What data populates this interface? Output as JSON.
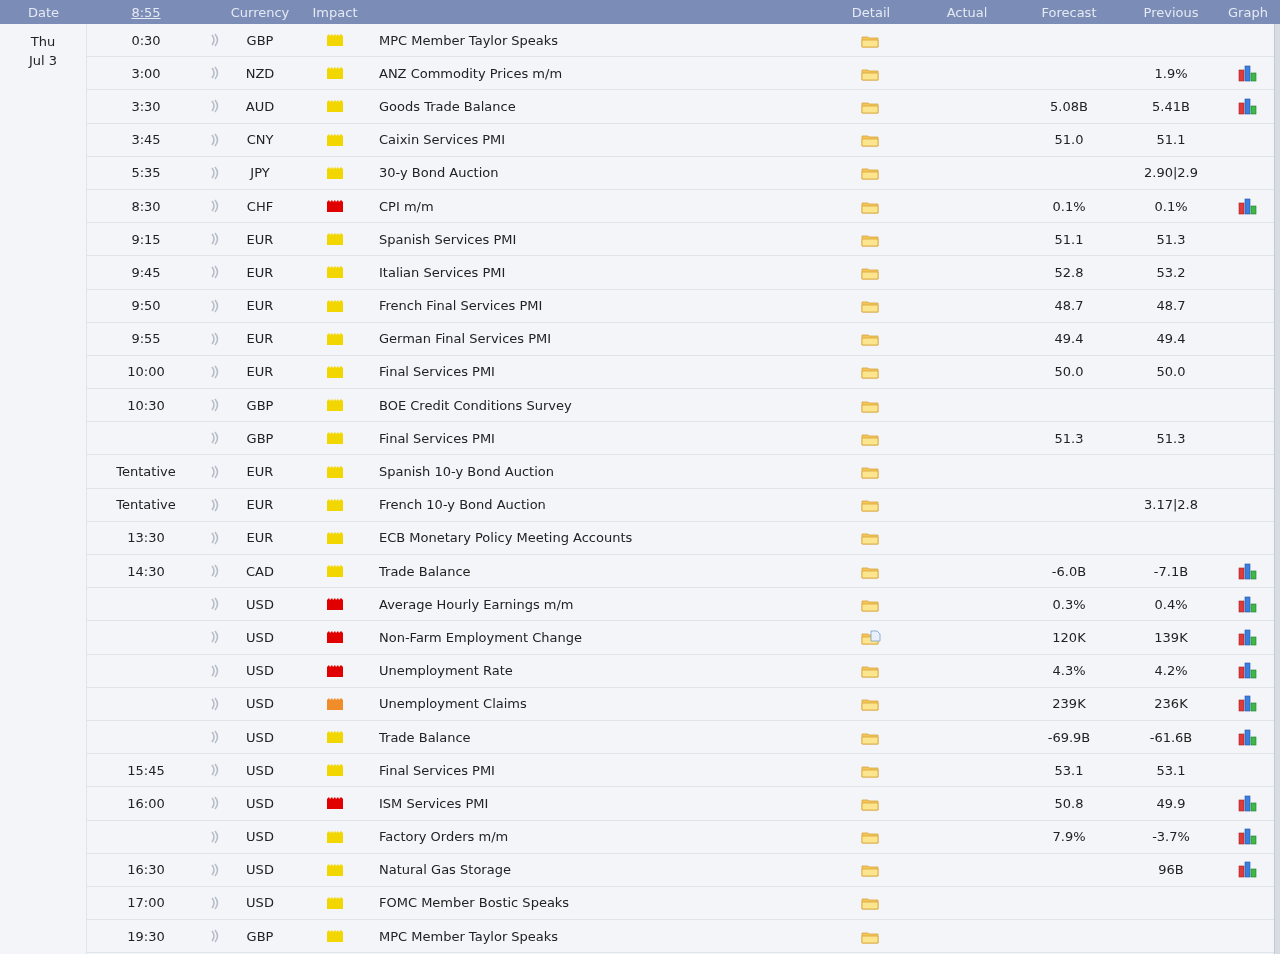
{
  "header": {
    "date": "Date",
    "clock": "8:55",
    "currency": "Currency",
    "impact": "Impact",
    "detail": "Detail",
    "actual": "Actual",
    "forecast": "Forecast",
    "previous": "Previous",
    "graph": "Graph"
  },
  "day": {
    "weekday": "Thu",
    "date": "Jul 3"
  },
  "events": [
    {
      "time": "0:30",
      "currency": "GBP",
      "color": "#f2d600",
      "title": "MPC Member Taylor Speaks",
      "detail_note": false,
      "graph": false
    },
    {
      "time": "3:00",
      "currency": "NZD",
      "color": "#f2d600",
      "title": "ANZ Commodity Prices m/m",
      "detail_note": false,
      "previous": "1.9%",
      "graph": true
    },
    {
      "time": "3:30",
      "currency": "AUD",
      "color": "#f2d600",
      "title": "Goods Trade Balance",
      "detail_note": false,
      "forecast": "5.08B",
      "previous": "5.41B",
      "graph": true
    },
    {
      "time": "3:45",
      "currency": "CNY",
      "color": "#f2d600",
      "title": "Caixin Services PMI",
      "detail_note": false,
      "forecast": "51.0",
      "previous": "51.1",
      "graph": false
    },
    {
      "time": "5:35",
      "currency": "JPY",
      "color": "#f2d600",
      "title": "30-y Bond Auction",
      "detail_note": false,
      "previous": "2.90|2.9",
      "graph": false
    },
    {
      "time": "8:30",
      "currency": "CHF",
      "color": "#e00000",
      "title": "CPI m/m",
      "detail_note": false,
      "forecast": "0.1%",
      "previous": "0.1%",
      "graph": true
    },
    {
      "time": "9:15",
      "currency": "EUR",
      "color": "#f2d600",
      "title": "Spanish Services PMI",
      "detail_note": false,
      "forecast": "51.1",
      "previous": "51.3",
      "graph": false
    },
    {
      "time": "9:45",
      "currency": "EUR",
      "color": "#f2d600",
      "title": "Italian Services PMI",
      "detail_note": false,
      "forecast": "52.8",
      "previous": "53.2",
      "graph": false
    },
    {
      "time": "9:50",
      "currency": "EUR",
      "color": "#f2d600",
      "title": "French Final Services PMI",
      "detail_note": false,
      "forecast": "48.7",
      "previous": "48.7",
      "graph": false
    },
    {
      "time": "9:55",
      "currency": "EUR",
      "color": "#f2d600",
      "title": "German Final Services PMI",
      "detail_note": false,
      "forecast": "49.4",
      "previous": "49.4",
      "graph": false
    },
    {
      "time": "10:00",
      "currency": "EUR",
      "color": "#f2d600",
      "title": "Final Services PMI",
      "detail_note": false,
      "forecast": "50.0",
      "previous": "50.0",
      "graph": false
    },
    {
      "time": "10:30",
      "currency": "GBP",
      "color": "#f2d600",
      "title": "BOE Credit Conditions Survey",
      "detail_note": false,
      "graph": false
    },
    {
      "currency": "GBP",
      "color": "#f2d600",
      "title": "Final Services PMI",
      "detail_note": false,
      "forecast": "51.3",
      "previous": "51.3",
      "graph": false
    },
    {
      "time": "Tentative",
      "currency": "EUR",
      "color": "#f2d600",
      "title": "Spanish 10-y Bond Auction",
      "detail_note": false,
      "graph": false
    },
    {
      "time": "Tentative",
      "currency": "EUR",
      "color": "#f2d600",
      "title": "French 10-y Bond Auction",
      "detail_note": false,
      "previous": "3.17|2.8",
      "graph": false
    },
    {
      "time": "13:30",
      "currency": "EUR",
      "color": "#f2d600",
      "title": "ECB Monetary Policy Meeting Accounts",
      "detail_note": false,
      "graph": false
    },
    {
      "time": "14:30",
      "currency": "CAD",
      "color": "#f2d600",
      "title": "Trade Balance",
      "detail_note": false,
      "forecast": "-6.0B",
      "previous": "-7.1B",
      "graph": true
    },
    {
      "currency": "USD",
      "color": "#e00000",
      "title": "Average Hourly Earnings m/m",
      "detail_note": false,
      "forecast": "0.3%",
      "previous": "0.4%",
      "graph": true
    },
    {
      "currency": "USD",
      "color": "#e00000",
      "title": "Non-Farm Employment Change",
      "detail_note": true,
      "forecast": "120K",
      "previous": "139K",
      "graph": true
    },
    {
      "currency": "USD",
      "color": "#e00000",
      "title": "Unemployment Rate",
      "detail_note": false,
      "forecast": "4.3%",
      "previous": "4.2%",
      "graph": true
    },
    {
      "currency": "USD",
      "color": "#f08c2a",
      "title": "Unemployment Claims",
      "detail_note": false,
      "forecast": "239K",
      "previous": "236K",
      "graph": true
    },
    {
      "currency": "USD",
      "color": "#f2d600",
      "title": "Trade Balance",
      "detail_note": false,
      "forecast": "-69.9B",
      "previous": "-61.6B",
      "graph": true
    },
    {
      "time": "15:45",
      "currency": "USD",
      "color": "#f2d600",
      "title": "Final Services PMI",
      "detail_note": false,
      "forecast": "53.1",
      "previous": "53.1",
      "graph": false
    },
    {
      "time": "16:00",
      "currency": "USD",
      "color": "#e00000",
      "title": "ISM Services PMI",
      "detail_note": false,
      "forecast": "50.8",
      "previous": "49.9",
      "graph": true
    },
    {
      "currency": "USD",
      "color": "#f2d600",
      "title": "Factory Orders m/m",
      "detail_note": false,
      "forecast": "7.9%",
      "previous": "-3.7%",
      "graph": true
    },
    {
      "time": "16:30",
      "currency": "USD",
      "color": "#f2d600",
      "title": "Natural Gas Storage",
      "detail_note": false,
      "previous": "96B",
      "graph": true
    },
    {
      "time": "17:00",
      "currency": "USD",
      "color": "#f2d600",
      "title": "FOMC Member Bostic Speaks",
      "detail_note": false,
      "graph": false
    },
    {
      "time": "19:30",
      "currency": "GBP",
      "color": "#f2d600",
      "title": "MPC Member Taylor Speaks",
      "detail_note": false,
      "graph": false
    }
  ]
}
